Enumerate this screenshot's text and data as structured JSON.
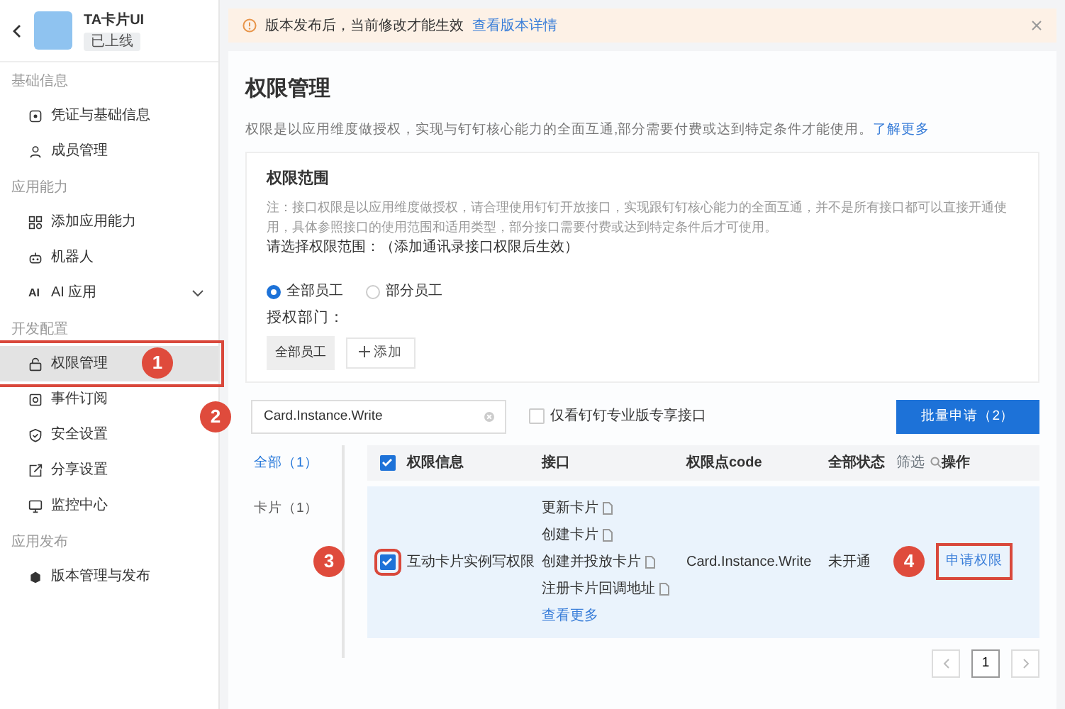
{
  "app": {
    "name": "TA卡片UI",
    "status": "已上线"
  },
  "sidebar": {
    "groups": [
      {
        "title": "基础信息",
        "items": [
          {
            "label": "凭证与基础信息",
            "kind": "credential",
            "selected": false
          },
          {
            "label": "成员管理",
            "kind": "person",
            "selected": false
          }
        ]
      },
      {
        "title": "应用能力",
        "items": [
          {
            "label": "添加应用能力",
            "kind": "grid",
            "selected": false
          },
          {
            "label": "机器人",
            "kind": "robot",
            "selected": false
          },
          {
            "label": "AI 应用",
            "icon_text": "AI",
            "expanded": false,
            "selected": false
          }
        ]
      },
      {
        "title": "开发配置",
        "items": [
          {
            "label": "权限管理",
            "kind": "lock",
            "selected": true
          },
          {
            "label": "事件订阅",
            "kind": "event",
            "selected": false
          },
          {
            "label": "安全设置",
            "kind": "shield",
            "selected": false
          },
          {
            "label": "分享设置",
            "kind": "share",
            "selected": false
          },
          {
            "label": "监控中心",
            "kind": "monitor",
            "selected": false
          }
        ]
      },
      {
        "title": "应用发布",
        "items": [
          {
            "label": "版本管理与发布",
            "kind": "box",
            "selected": false
          }
        ]
      }
    ]
  },
  "notice": {
    "text": "版本发布后，当前修改才能生效",
    "link": "查看版本详情"
  },
  "page": {
    "title": "权限管理",
    "description": "权限是以应用维度做授权，实现与钉钉核心能力的全面互通,部分需要付费或达到特定条件才能使用。",
    "link": "了解更多"
  },
  "scope": {
    "title": "权限范围",
    "note": "注：接口权限是以应用维度做授权，请合理使用钉钉开放接口，实现跟钉钉核心能力的全面互通，并不是所有接口都可以直接开通使用，具体参照接口的使用范围和适用类型，部分接口需要付费或达到特定条件后才可使用。",
    "prompt": "请选择权限范围：（添加通讯录接口权限后生效）",
    "options": [
      {
        "label": "全部员工",
        "selected": true
      },
      {
        "label": "部分员工",
        "selected": false
      }
    ],
    "dept_label": "授权部门：",
    "depts": [
      "全部员工"
    ],
    "add": "添加"
  },
  "filter": {
    "search_value": "Card.Instance.Write",
    "pro_only": {
      "label": "仅看钉钉专业版专享接口",
      "checked": false
    },
    "batch": "批量申请（2）"
  },
  "categories": [
    {
      "label": "全部（1）",
      "selected": true
    },
    {
      "label": "卡片（1）",
      "selected": false
    }
  ],
  "table": {
    "columns": [
      "权限信息",
      "接口",
      "权限点code",
      "全部状态",
      "操作"
    ],
    "filter_label": "筛选",
    "header_checked": true,
    "rows": [
      {
        "checked": true,
        "name": "互动卡片实例写权限",
        "apis": [
          "更新卡片",
          "创建卡片",
          "创建并投放卡片",
          "注册卡片回调地址"
        ],
        "more": "查看更多",
        "code": "Card.Instance.Write",
        "status": "未开通",
        "action": "申请权限"
      }
    ]
  },
  "pagination": {
    "pages": [
      {
        "label": "1",
        "selected": true
      }
    ]
  },
  "annotations": [
    {
      "label": "1",
      "kind": "sidebar-item"
    },
    {
      "label": "2",
      "kind": "search"
    },
    {
      "label": "3",
      "kind": "row-checkbox"
    },
    {
      "label": "4",
      "kind": "action"
    }
  ]
}
